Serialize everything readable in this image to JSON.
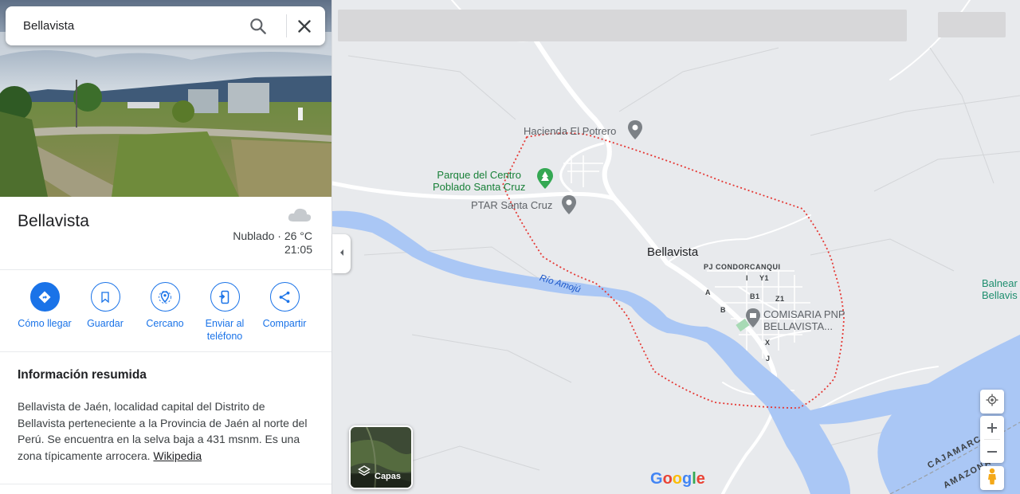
{
  "search": {
    "value": "Bellavista"
  },
  "place": {
    "title": "Bellavista",
    "weather": {
      "condition": "Nublado · 26 °C",
      "time": "21:05"
    }
  },
  "actions": [
    {
      "label": "Cómo llegar",
      "icon": "directions-icon"
    },
    {
      "label": "Guardar",
      "icon": "bookmark-icon"
    },
    {
      "label": "Cercano",
      "icon": "nearby-icon"
    },
    {
      "label": "Enviar al teléfono",
      "icon": "send-to-phone-icon"
    },
    {
      "label": "Compartir",
      "icon": "share-icon"
    }
  ],
  "summary": {
    "title": "Información resumida",
    "text": "Bellavista de Jaén, localidad capital del Distrito de Bellavista perteneciente a la Provincia de Jaén al norte del Perú. Se encuentra en la selva baja a 431 msnm. Es una zona típicamente arrocera.",
    "link": "Wikipedia"
  },
  "map": {
    "labels": {
      "hacienda": "Hacienda El Potrero",
      "parque_line1": "Parque del Centro",
      "parque_line2": "Poblado Santa Cruz",
      "ptar": "PTAR Santa Cruz",
      "town": "Bellavista",
      "pj": "PJ CONDORCANQUI",
      "i": "I",
      "y1": "Y1",
      "b1": "B1",
      "z1": "Z1",
      "a": "A",
      "b": "B",
      "x": "X",
      "j": "J",
      "comisaria_line1": "COMISARIA PNP",
      "comisaria_line2": "BELLAVISTA...",
      "river": "Río Amojú",
      "balnear_line1": "Balnear",
      "balnear_line2": "Bellavis",
      "cajamarca": "CAJAMARCA",
      "amazonas": "AMAZONAS"
    },
    "layers_label": "Capas",
    "logo": "Google",
    "colors": {
      "water": "#aac7f5",
      "boundary": "#e53935",
      "accent": "#1a73e8",
      "land": "#e8eaed"
    }
  }
}
